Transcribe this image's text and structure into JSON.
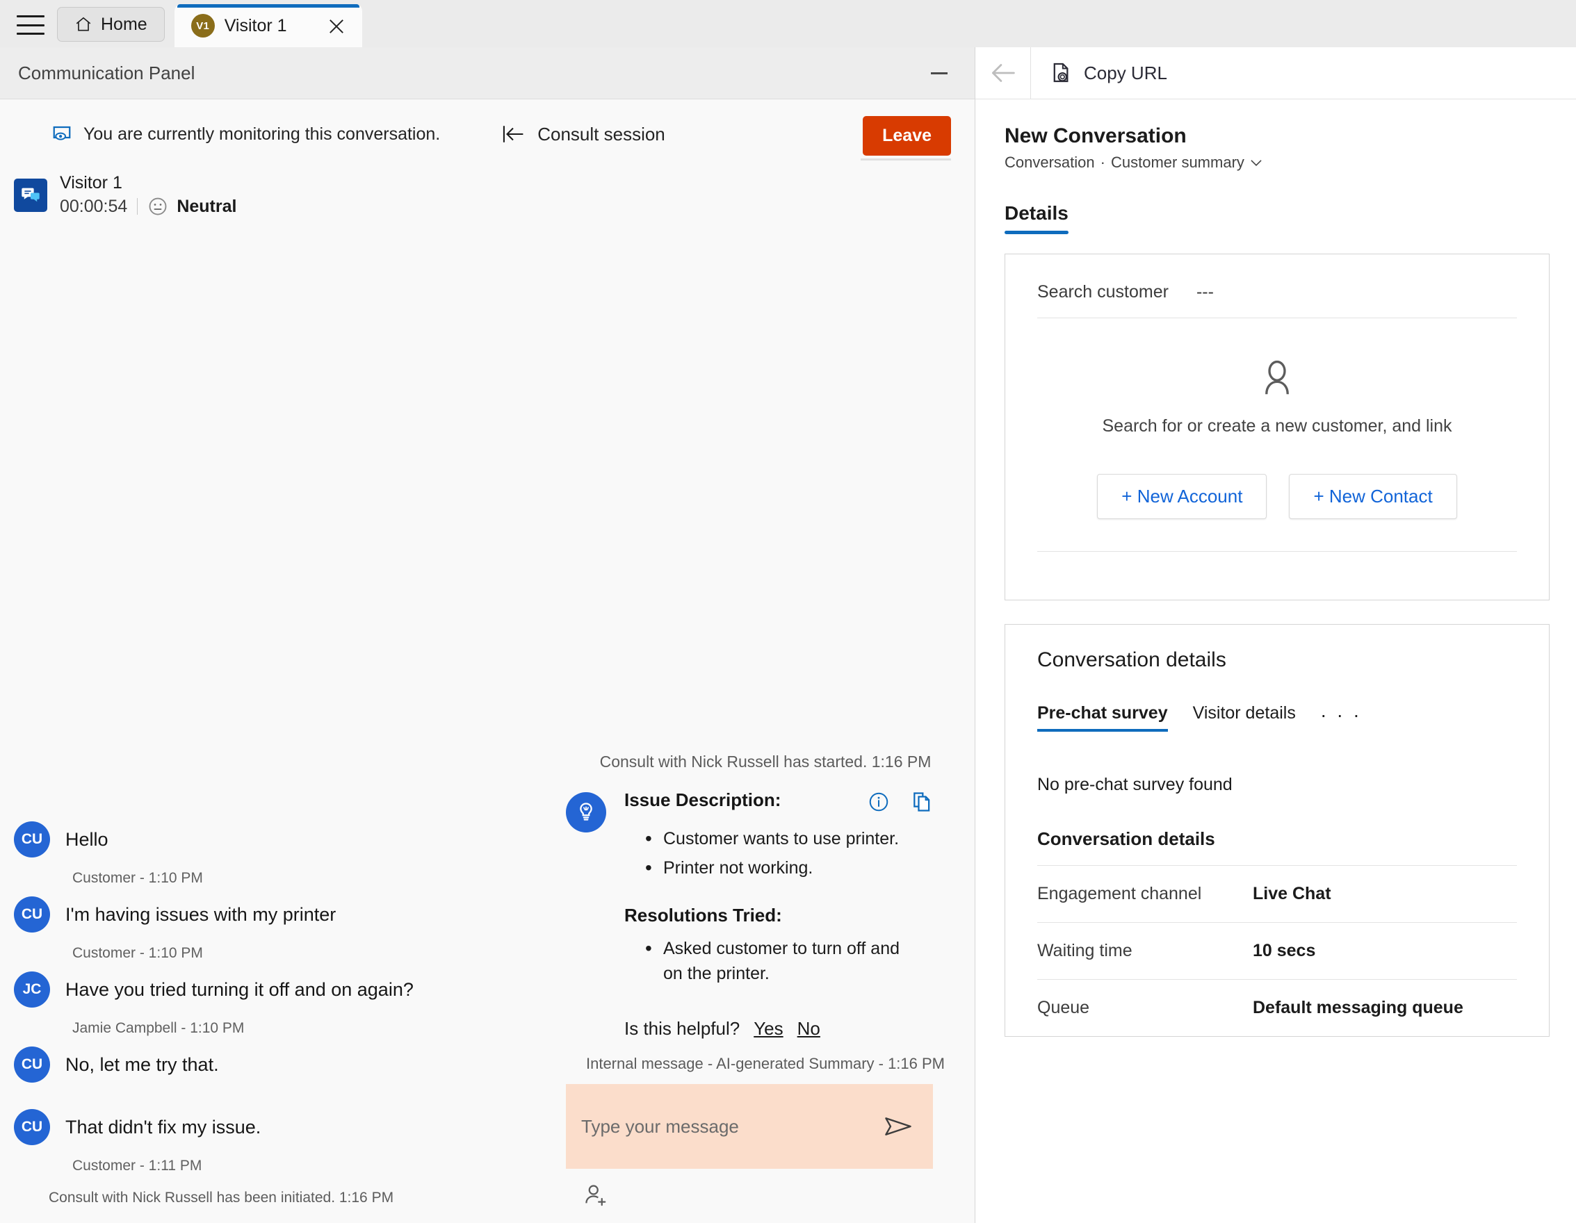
{
  "tabstrip": {
    "menu_icon": "hamburger-icon",
    "home_label": "Home",
    "visitor_tab": {
      "badge": "V1",
      "label": "Visitor 1",
      "close_icon": "close-icon"
    }
  },
  "comm_panel": {
    "title": "Communication Panel",
    "minimize_icon": "minimize-icon",
    "monitoring_note": "You are currently monitoring this conversation.",
    "monitoring_icon": "monitor-eye-icon",
    "consult_session_label": "Consult session",
    "consult_back_icon": "collapse-left-icon",
    "leave_label": "Leave",
    "leave_color": "#d83b01",
    "visitor": {
      "name": "Visitor 1",
      "timer": "00:00:54",
      "sentiment": "Neutral",
      "sentiment_icon": "neutral-face-icon",
      "channel_icon": "chat-icon"
    }
  },
  "transcript": {
    "messages": [
      {
        "initials": "CU",
        "text": "Hello",
        "meta": "Customer - 1:10 PM"
      },
      {
        "initials": "CU",
        "text": "I'm having issues with my printer",
        "meta": "Customer - 1:10 PM"
      },
      {
        "initials": "JC",
        "text": "Have you tried turning it off and on again?",
        "meta": "Jamie Campbell - 1:10 PM"
      },
      {
        "initials": "CU",
        "text": "No, let me try that.",
        "meta": ""
      },
      {
        "initials": "CU",
        "text": "That didn't fix my issue.",
        "meta": "Customer - 1:11 PM"
      }
    ],
    "system_line": "Consult with Nick Russell has been initiated. 1:16 PM"
  },
  "summary": {
    "system_line": "Consult with Nick Russell has started. 1:16 PM",
    "bulb_icon": "lightbulb-icon",
    "info_icon": "info-icon",
    "copy_icon": "copy-icon",
    "issue_heading": "Issue Description:",
    "issue_items": [
      "Customer wants to use printer.",
      "Printer not working."
    ],
    "resolutions_heading": "Resolutions Tried:",
    "resolution_items": [
      "Asked customer to turn off and on the printer."
    ],
    "helpful_question": "Is this helpful?",
    "helpful_yes": "Yes",
    "helpful_no": "No",
    "footer": "Internal message - AI-generated Summary - 1:16 PM"
  },
  "composer": {
    "placeholder": "Type your message",
    "value": "",
    "send_icon": "send-icon",
    "add_participant_icon": "add-person-icon",
    "background_color": "#fbddcb"
  },
  "right_panel": {
    "back_icon": "back-arrow-icon",
    "copy_url_label": "Copy URL",
    "copy_url_icon": "copy-url-icon",
    "conversation_title": "New Conversation",
    "breadcrumb_primary": "Conversation",
    "breadcrumb_separator": "·",
    "breadcrumb_secondary": "Customer summary",
    "breadcrumb_chevron_icon": "chevron-down-icon",
    "tabs": [
      {
        "label": "Details",
        "active": true
      }
    ],
    "customer_card": {
      "search_label": "Search customer",
      "search_value": "---",
      "person_icon": "person-icon",
      "empty_text": "Search for or create a new customer, and link",
      "new_account_label": "+ New Account",
      "new_contact_label": "+ New Contact"
    },
    "conversation_card": {
      "title": "Conversation details",
      "subtabs": [
        {
          "label": "Pre-chat survey",
          "active": true
        },
        {
          "label": "Visitor details",
          "active": false
        }
      ],
      "more_label": ". . .",
      "no_survey_text": "No pre-chat survey found",
      "details_title": "Conversation details",
      "rows": [
        {
          "key": "Engagement channel",
          "value": "Live Chat"
        },
        {
          "key": "Waiting time",
          "value": "10 secs"
        },
        {
          "key": "Queue",
          "value": "Default messaging queue"
        }
      ]
    }
  }
}
